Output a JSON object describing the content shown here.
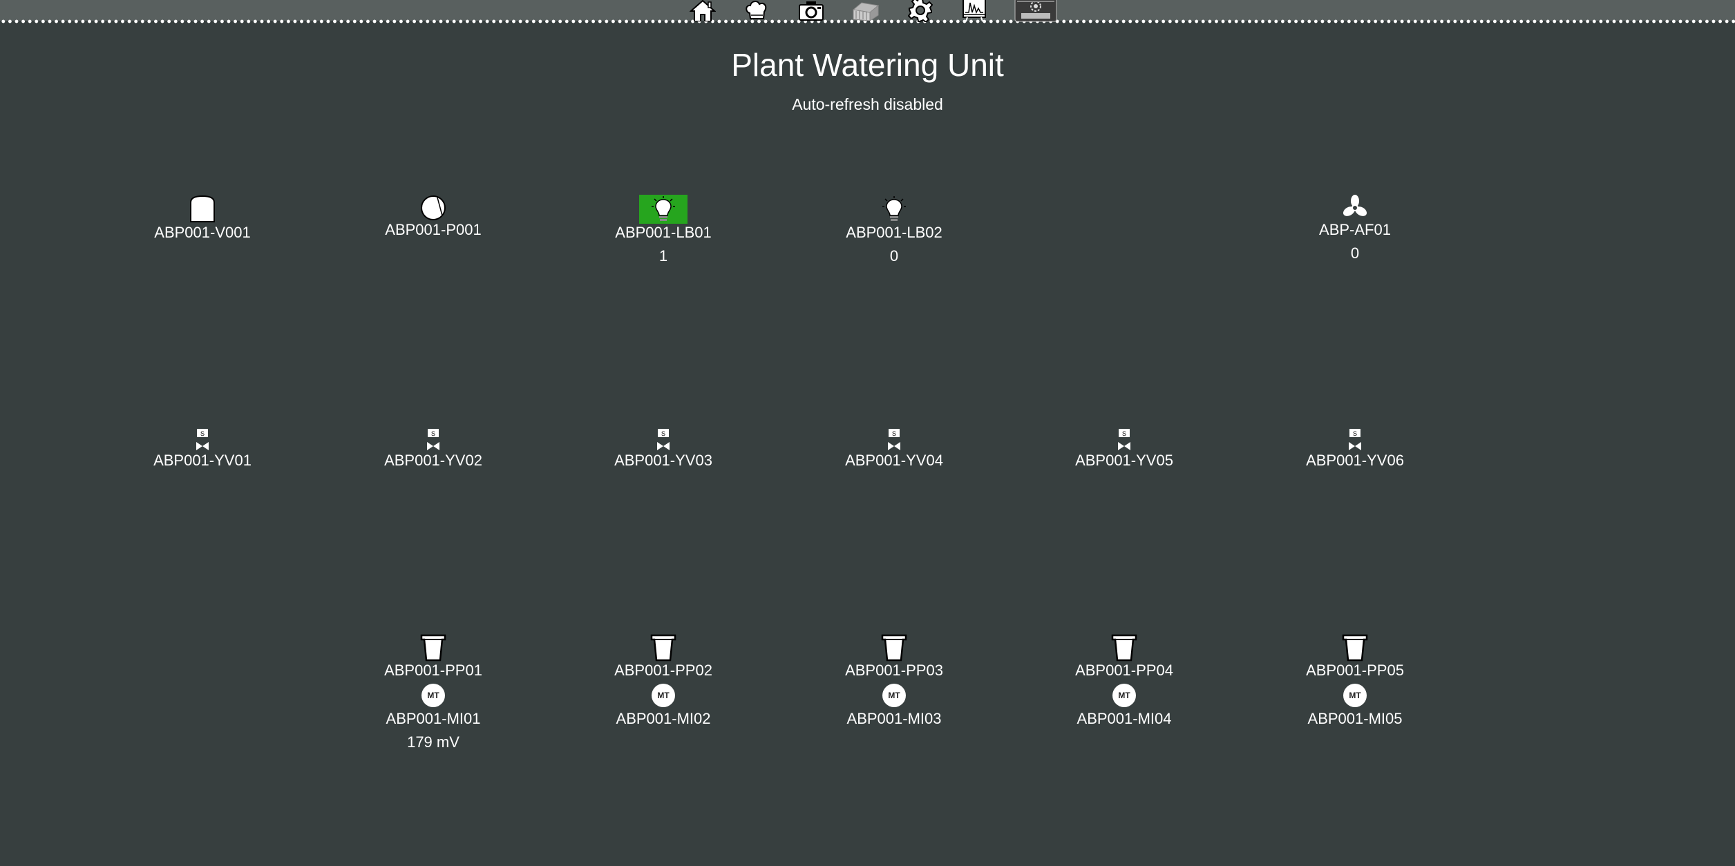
{
  "nav": {
    "items": [
      {
        "name": "home-icon",
        "label": "Home"
      },
      {
        "name": "chef-hat-icon",
        "label": "Kitchen"
      },
      {
        "name": "camera-icon",
        "label": "Camera"
      },
      {
        "name": "greenhouse-icon",
        "label": "Greenhouse"
      },
      {
        "name": "gear-icon",
        "label": "Settings"
      },
      {
        "name": "chart-monitor-icon",
        "label": "Trends"
      },
      {
        "name": "gomes-logo-icon",
        "label": "GOMES"
      }
    ]
  },
  "page": {
    "title": "Plant Watering Unit",
    "subtitle": "Auto-refresh disabled"
  },
  "row1": {
    "v001": {
      "label": "ABP001-V001",
      "icon": "tank-icon"
    },
    "p001": {
      "label": "ABP001-P001",
      "icon": "pump-icon"
    },
    "lb01": {
      "label": "ABP001-LB01",
      "value": "1",
      "state": "on",
      "on_color": "#26a51e",
      "icon": "lightbulb-icon"
    },
    "lb02": {
      "label": "ABP001-LB02",
      "value": "0",
      "state": "off",
      "icon": "lightbulb-icon"
    },
    "af01": {
      "label": "ABP-AF01",
      "value": "0",
      "icon": "fan-icon"
    }
  },
  "valves": [
    {
      "label": "ABP001-YV01"
    },
    {
      "label": "ABP001-YV02"
    },
    {
      "label": "ABP001-YV03"
    },
    {
      "label": "ABP001-YV04"
    },
    {
      "label": "ABP001-YV05"
    },
    {
      "label": "ABP001-YV06"
    }
  ],
  "pots": [
    {
      "label": "ABP001-PP01",
      "sensor_badge": "MT",
      "sensor_label": "ABP001-MI01",
      "reading": "179 mV"
    },
    {
      "label": "ABP001-PP02",
      "sensor_badge": "MT",
      "sensor_label": "ABP001-MI02"
    },
    {
      "label": "ABP001-PP03",
      "sensor_badge": "MT",
      "sensor_label": "ABP001-MI03"
    },
    {
      "label": "ABP001-PP04",
      "sensor_badge": "MT",
      "sensor_label": "ABP001-MI04"
    },
    {
      "label": "ABP001-PP05",
      "sensor_badge": "MT",
      "sensor_label": "ABP001-MI05"
    }
  ],
  "colors": {
    "background": "#373f3f",
    "topbar": "#59605f",
    "lamp_on": "#26a51e",
    "text": "#ffffff"
  }
}
